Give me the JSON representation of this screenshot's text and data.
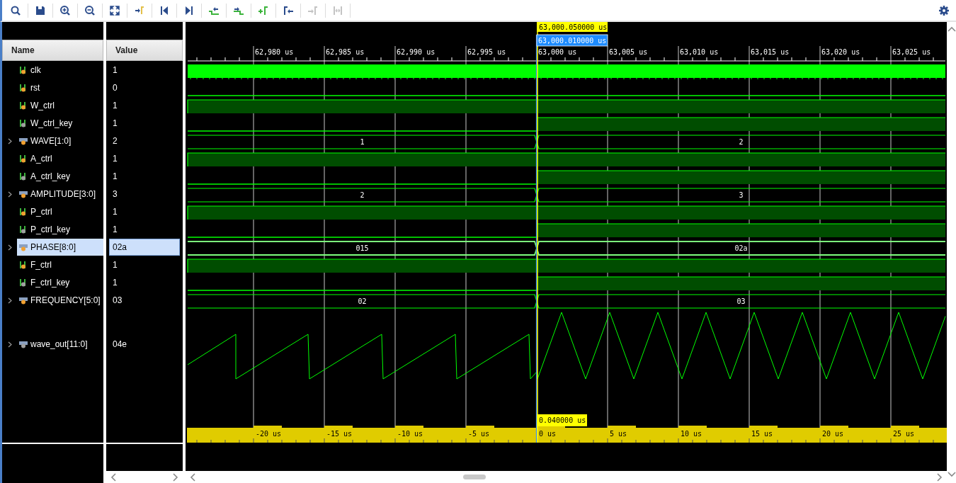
{
  "toolbar": {
    "buttons": [
      {
        "kind": "search",
        "disabled": false
      },
      {
        "kind": "save",
        "disabled": false
      },
      {
        "kind": "zoom-in",
        "disabled": false
      },
      {
        "kind": "zoom-out",
        "disabled": false
      },
      {
        "kind": "zoom-fit",
        "disabled": false
      },
      {
        "kind": "go-to-cursor",
        "disabled": false
      },
      {
        "kind": "go-to-start",
        "disabled": false
      },
      {
        "kind": "go-to-end",
        "disabled": false
      },
      {
        "kind": "previous-transition",
        "disabled": false
      },
      {
        "kind": "next-transition",
        "disabled": false
      },
      {
        "kind": "add-marker",
        "disabled": false
      },
      {
        "kind": "previous-marker",
        "disabled": false
      },
      {
        "kind": "next-marker",
        "disabled": true
      },
      {
        "kind": "swap-cursors",
        "disabled": true
      }
    ],
    "settings": {
      "kind": "settings"
    }
  },
  "columns": {
    "name": "Name",
    "value": "Value"
  },
  "signals": [
    {
      "name": "clk",
      "value": "1",
      "kind": "clock",
      "color": "#f0a030",
      "selected": false
    },
    {
      "name": "rst",
      "value": "0",
      "kind": "bit",
      "color": "#f0a030",
      "selected": false,
      "high_before": false,
      "high_after": false
    },
    {
      "name": "W_ctrl",
      "value": "1",
      "kind": "bit",
      "color": "#f0a030",
      "selected": false,
      "high_before": true,
      "high_after": true
    },
    {
      "name": "W_ctrl_key",
      "value": "1",
      "kind": "bit",
      "color": "#a0a0a0",
      "selected": false,
      "high_before": false,
      "high_after": true
    },
    {
      "name": "WAVE[1:0]",
      "value": "2",
      "kind": "bus",
      "color": "#f0a030",
      "selected": false,
      "before": "1",
      "after": "2"
    },
    {
      "name": "A_ctrl",
      "value": "1",
      "kind": "bit",
      "color": "#f0a030",
      "selected": false,
      "high_before": true,
      "high_after": true
    },
    {
      "name": "A_ctrl_key",
      "value": "1",
      "kind": "bit",
      "color": "#a0a0a0",
      "selected": false,
      "high_before": false,
      "high_after": true
    },
    {
      "name": "AMPLITUDE[3:0]",
      "value": "3",
      "kind": "bus",
      "color": "#f0a030",
      "selected": false,
      "before": "2",
      "after": "3"
    },
    {
      "name": "P_ctrl",
      "value": "1",
      "kind": "bit",
      "color": "#f0a030",
      "selected": false,
      "high_before": true,
      "high_after": true
    },
    {
      "name": "P_ctrl_key",
      "value": "1",
      "kind": "bit",
      "color": "#a0a0a0",
      "selected": false,
      "high_before": false,
      "high_after": true
    },
    {
      "name": "PHASE[8:0]",
      "value": "02a",
      "kind": "bus",
      "color": "#f0a030",
      "selected": true,
      "before": "015",
      "after": "02a"
    },
    {
      "name": "F_ctrl",
      "value": "1",
      "kind": "bit",
      "color": "#f0a030",
      "selected": false,
      "high_before": true,
      "high_after": true
    },
    {
      "name": "F_ctrl_key",
      "value": "1",
      "kind": "bit",
      "color": "#a0a0a0",
      "selected": false,
      "high_before": false,
      "high_after": true
    },
    {
      "name": "FREQUENCY[5:0]",
      "value": "03",
      "kind": "bus",
      "color": "#f0a030",
      "selected": false,
      "before": "02",
      "after": "03"
    },
    {
      "name": "wave_out[11:0]",
      "value": "04e",
      "kind": "analog",
      "color": "#a0a0a0",
      "selected": false
    }
  ],
  "timeline": {
    "top_labels": [
      "62,980 us",
      "62,985 us",
      "62,990 us",
      "62,995 us",
      "63,000 us",
      "63,005 us",
      "63,010 us",
      "63,015 us",
      "63,020 us",
      "63,025 us"
    ],
    "bottom_labels": [
      "-20 us",
      "-15 us",
      "-10 us",
      "-5 us",
      "0 us",
      "5 us",
      "10 us",
      "15 us",
      "20 us",
      "25 us"
    ],
    "cursor_time": "63,000.050000 us",
    "marker_time": "63,000.010000 us",
    "delta": "0.040000 us"
  }
}
